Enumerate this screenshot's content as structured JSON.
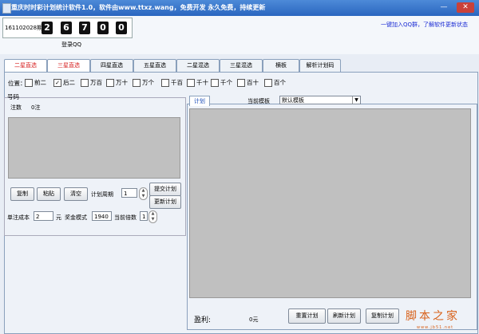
{
  "window": {
    "title": "重庆时时彩计划统计软件1.0，软件由www.ttxz.wang，免费开发 永久免费，持续更新",
    "minimize_glyph": "—",
    "close_glyph": "✕"
  },
  "header": {
    "period_label": "161102028期",
    "digits": [
      "2",
      "6",
      "7",
      "0",
      "0"
    ],
    "login_label": "登录QQ",
    "qq_link": "一键加入QQ群，了解软件更新状态"
  },
  "tabs": [
    {
      "label": "二星直选",
      "active": true
    },
    {
      "label": "三星直选",
      "active": true
    },
    {
      "label": "四星直选",
      "active": false
    },
    {
      "label": "五星直选",
      "active": false
    },
    {
      "label": "二星混选",
      "active": false
    },
    {
      "label": "三星混选",
      "active": false
    },
    {
      "label": "横板",
      "active": false
    },
    {
      "label": "解析计划码",
      "active": false
    }
  ],
  "positions": {
    "label": "位置：",
    "options": [
      {
        "label": "前二",
        "checked": false
      },
      {
        "label": "后二",
        "checked": true
      },
      {
        "label": "万百",
        "checked": false
      },
      {
        "label": "万十",
        "checked": false
      },
      {
        "label": "万个",
        "checked": false
      },
      {
        "label": "千百",
        "checked": false
      },
      {
        "label": "千十",
        "checked": false
      },
      {
        "label": "千个",
        "checked": false
      },
      {
        "label": "百十",
        "checked": false
      },
      {
        "label": "百个",
        "checked": false
      }
    ]
  },
  "code_group": {
    "title": "号码",
    "count_label": "注数",
    "count_value": "0注",
    "copy_button": "复制",
    "paste_button": "粘贴",
    "clear_button": "清空",
    "cycle_label": "计划周期",
    "cycle_value": "1",
    "submit_button": "提交计划",
    "update_button": "更新计划",
    "unit_cost_label": "单注成本",
    "unit_cost_value": "2",
    "unit_label": "元",
    "prize_mode_label": "奖金模式",
    "prize_mode_value": "1940",
    "multiple_label": "当前倍数",
    "multiple_value": "1"
  },
  "plan": {
    "tab_label": "计划",
    "template_label": "当前模板",
    "template_value": "默认模板",
    "profit_label": "盈利:",
    "profit_value": "0元",
    "reset_button": "重置计划",
    "refresh_button": "刷新计划",
    "copy_plan_button": "复制计划"
  },
  "watermark": {
    "text": "脚本之家",
    "url": "www.jb51.net"
  },
  "colors": {
    "title_bar": "#2f6fc9",
    "active_tab": "#d61f1f",
    "qq_link": "#1a2bd4",
    "watermark": "#d8611a"
  },
  "icons": [
    "app-icon",
    "minimize-icon",
    "close-icon",
    "spin-up-icon",
    "spin-down-icon",
    "dropdown-arrow-icon",
    "checkbox-icon"
  ]
}
